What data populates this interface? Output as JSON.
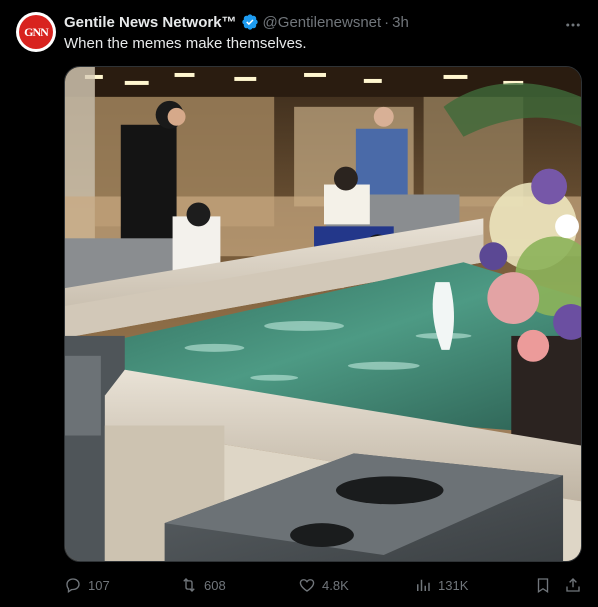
{
  "tweet": {
    "avatar_text": "GNN",
    "display_name": "Gentile News Network™",
    "verified": true,
    "handle": "@Gentilenewsnet",
    "separator": "·",
    "time": "3h",
    "text": "When the memes make themselves."
  },
  "actions": {
    "replies": "107",
    "retweets": "608",
    "likes": "4.8K",
    "views": "131K"
  },
  "icons": {
    "more": "more-dots-icon",
    "verified": "verified-badge-icon",
    "reply": "reply-icon",
    "retweet": "retweet-icon",
    "like": "heart-icon",
    "views": "views-chart-icon",
    "bookmark": "bookmark-icon",
    "share": "share-icon"
  },
  "colors": {
    "background": "#000000",
    "text": "#e7e9ea",
    "muted": "#71767b",
    "verified": "#1d9bf0",
    "avatar_red": "#d8231f"
  }
}
